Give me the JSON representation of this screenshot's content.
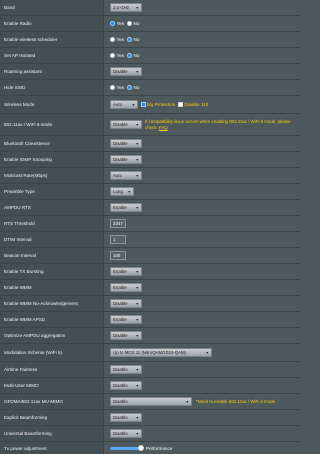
{
  "rows": {
    "band": {
      "label": "Band",
      "value": "2.4 GHz"
    },
    "enable_radio": {
      "label": "Enable Radio",
      "yes": "Yes",
      "no": "No"
    },
    "enable_scheduler": {
      "label": "Enable wireless scheduler",
      "yes": "Yes",
      "no": "No"
    },
    "set_ap_isolated": {
      "label": "Set AP Isolated",
      "yes": "Yes",
      "no": "No"
    },
    "roaming_assistant": {
      "label": "Roaming assistant",
      "value": "Disable"
    },
    "hide_ssid": {
      "label": "Hide SSID",
      "yes": "Yes",
      "no": "No"
    },
    "wireless_mode": {
      "label": "Wireless Mode",
      "value": "Auto",
      "opt1": "b/g Protection",
      "opt2": "Disable 11b"
    },
    "ax_mode": {
      "label": "802.11ax / WiFi 6 mode",
      "value": "Disable",
      "warning": "If compatibility issue occurs when enabling 802.11ax / WiFi 6 mode, please check:",
      "faq": "FAQ"
    },
    "bluetooth": {
      "label": "Bluetooth Coexistence",
      "value": "Disable"
    },
    "igmp": {
      "label": "Enable IGMP Snooping",
      "value": "Disable"
    },
    "multicast": {
      "label": "Multicast Rate(Mbps)",
      "value": "Auto"
    },
    "preamble": {
      "label": "Preamble Type",
      "value": "Long"
    },
    "ampdu_rts": {
      "label": "AMPDU RTS",
      "value": "Enable"
    },
    "rts_threshold": {
      "label": "RTS Threshold",
      "value": "2347"
    },
    "dtim": {
      "label": "DTIM Interval",
      "value": "1"
    },
    "beacon": {
      "label": "Beacon Interval",
      "value": "100"
    },
    "tx_bursting": {
      "label": "Enable TX Bursting",
      "value": "Enable"
    },
    "wmm": {
      "label": "Enable WMM",
      "value": "Enable"
    },
    "wmm_noack": {
      "label": "Enable WMM No-Acknowledgement",
      "value": "Disable"
    },
    "wmm_apsd": {
      "label": "Enable WMM APSD",
      "value": "Enable"
    },
    "ampdu_agg": {
      "label": "Optimize AMPDU aggregation",
      "value": "Disable"
    },
    "modulation": {
      "label": "Modulation Scheme (WiFi 5)",
      "value": "Up to MCS 11 (NitroQAM/1024-QAM)"
    },
    "airtime": {
      "label": "Airtime Fairness",
      "value": "Disable"
    },
    "mu_mimo": {
      "label": "Multi-User MIMO",
      "value": "Disable"
    },
    "ofdma": {
      "label": "OFDMA/802.11ax MU-MIMO",
      "value": "Disable",
      "note": "*Need to enable",
      "note_link": "802.11ax / WiFi 6 mode"
    },
    "explicit_bf": {
      "label": "Explicit Beamforming",
      "value": "Disable"
    },
    "universal_bf": {
      "label": "Universal Beamforming",
      "value": "Disable"
    },
    "tx_power": {
      "label": "Tx power adjustment",
      "value_text": "Performance",
      "level": 1.0
    }
  },
  "colors": {
    "accent": "#1f86e6",
    "warning": "#ffcc00",
    "background": "#4d595d"
  }
}
